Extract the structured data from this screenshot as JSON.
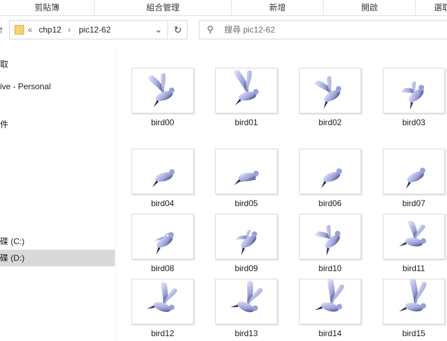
{
  "ribbon": {
    "groups": [
      "剪貼簿",
      "組合管理",
      "新增",
      "開啟",
      "選取"
    ]
  },
  "address": {
    "crumbs": [
      "«",
      "chp12",
      "›",
      "pic12-62"
    ],
    "search_placeholder": "搜尋 pic12-62"
  },
  "icons": {
    "up": "up-arrow-icon",
    "folder": "folder-icon",
    "dropdown": "chevron-down-icon",
    "refresh": "refresh-icon",
    "search": "search-icon"
  },
  "nav": {
    "items": [
      {
        "label": "取"
      },
      {
        "label": "ive - Personal"
      },
      {
        "label": "件"
      },
      {
        "label": "碟 (C:)"
      },
      {
        "label": "碟 (D:)",
        "selected": true
      }
    ]
  },
  "files": [
    {
      "name": "bird00"
    },
    {
      "name": "bird01"
    },
    {
      "name": "bird02"
    },
    {
      "name": "bird03"
    },
    {
      "name": "bird04"
    },
    {
      "name": "bird05"
    },
    {
      "name": "bird06"
    },
    {
      "name": "bird07"
    },
    {
      "name": "bird08"
    },
    {
      "name": "bird09"
    },
    {
      "name": "bird10"
    },
    {
      "name": "bird11"
    },
    {
      "name": "bird12"
    },
    {
      "name": "bird13"
    },
    {
      "name": "bird14"
    },
    {
      "name": "bird15"
    }
  ],
  "colors": {
    "selected_nav": "#d9d9d9",
    "bird_body": "#9aa0d8",
    "bird_shadow": "#2f2f5a"
  }
}
